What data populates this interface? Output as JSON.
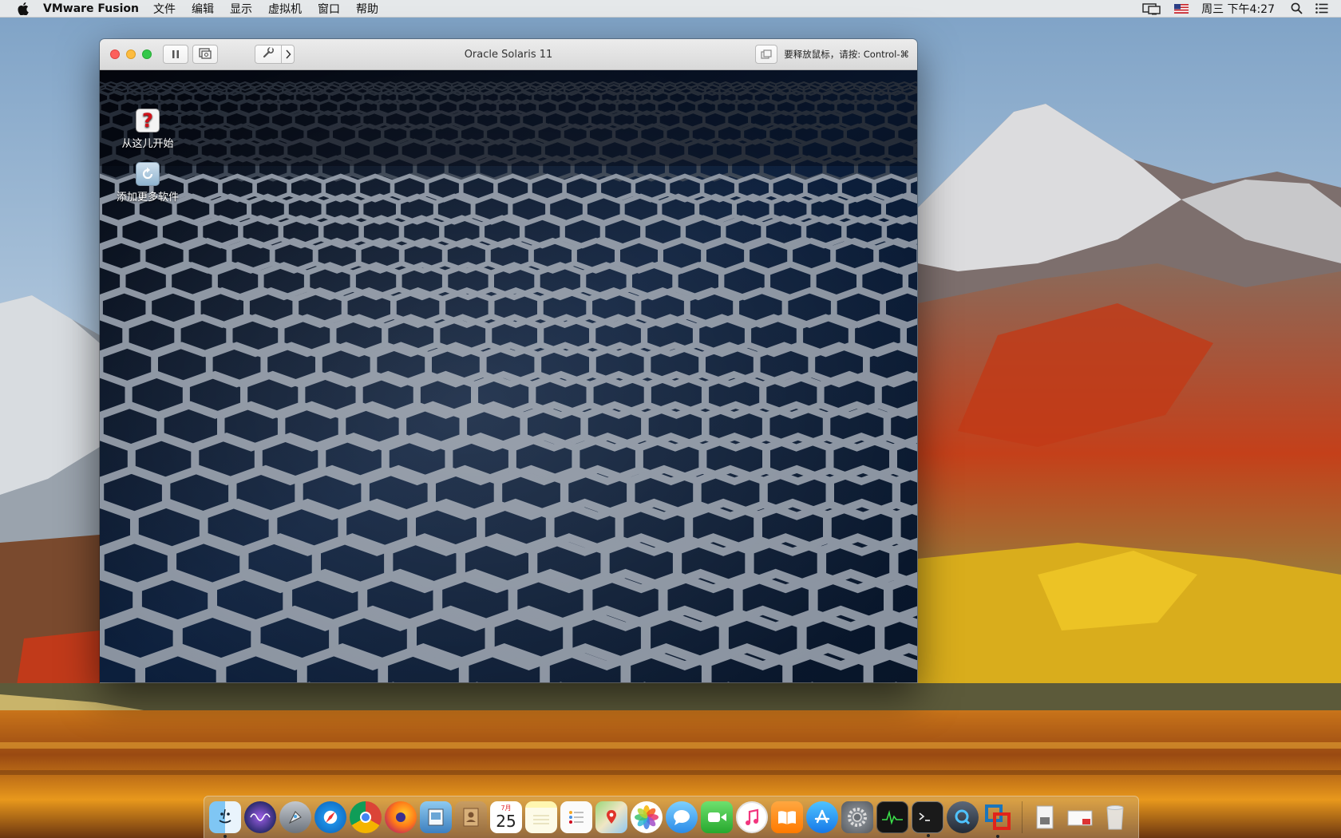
{
  "menubar": {
    "app_name": "VMware Fusion",
    "menus": [
      "文件",
      "编辑",
      "显示",
      "虚拟机",
      "窗口",
      "帮助"
    ],
    "clock": "周三 下午4:27"
  },
  "vm_window": {
    "title": "Oracle Solaris 11",
    "release_hint": "要释放鼠标，请按: Control-⌘"
  },
  "guest_desktop": {
    "icons": [
      {
        "label": "从这儿开始",
        "icon": "help-question-icon"
      },
      {
        "label": "添加更多软件",
        "icon": "add-software-icon"
      }
    ]
  },
  "dock": {
    "calendar": {
      "month": "7月",
      "day": "25"
    },
    "apps": [
      "finder-icon",
      "siri-icon",
      "launchpad-icon",
      "safari-icon",
      "chrome-icon",
      "firefox-icon",
      "preview-icon",
      "contacts-icon",
      "calendar-icon",
      "notes-icon",
      "reminders-icon",
      "maps-icon",
      "photos-icon",
      "messages-icon",
      "facetime-icon",
      "itunes-icon",
      "ibooks-icon",
      "app-store-icon",
      "system-preferences-icon",
      "activity-monitor-icon",
      "terminal-icon",
      "quicktime-icon",
      "vmware-fusion-icon",
      "documents-folder-icon",
      "downloads-folder-icon",
      "trash-icon"
    ]
  }
}
